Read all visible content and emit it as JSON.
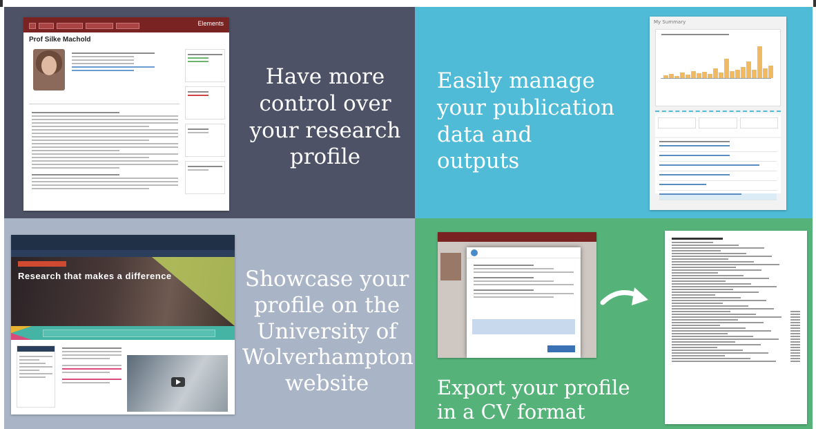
{
  "panels": {
    "control": {
      "caption": "Have more control over your research profile",
      "color": "#4d5266",
      "screenshot": {
        "brand": "Elements",
        "name": "Prof Silke Machold"
      }
    },
    "manage": {
      "caption": "Easily manage your publication data and outputs",
      "color": "#4fbbd6",
      "screenshot": {
        "header": "My Summary",
        "bar_color": "#f0b964"
      }
    },
    "showcase": {
      "caption": "Showcase your profile on the University of Wolverhampton website",
      "color": "#a9b5c6",
      "screenshot": {
        "hero_heading": "Research that makes a difference"
      }
    },
    "export": {
      "caption": "Export your profile in a CV format",
      "color": "#55b37a",
      "icons": {
        "arrow": "curved-arrow-icon"
      }
    }
  }
}
